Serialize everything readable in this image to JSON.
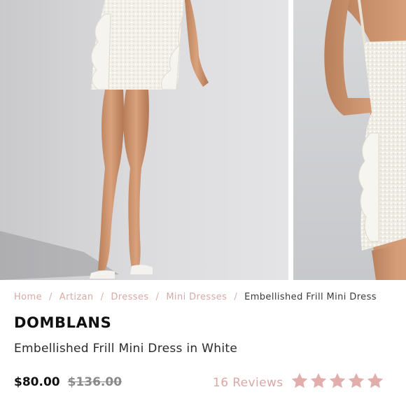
{
  "breadcrumb": [
    {
      "label": "Home"
    },
    {
      "label": "Artizan"
    },
    {
      "label": "Dresses"
    },
    {
      "label": "Mini Dresses"
    }
  ],
  "breadcrumb_separator": "/",
  "breadcrumb_current": "Embellished Frill Mini Dress",
  "product": {
    "brand": "DOMBLANS",
    "name": "Embellished Frill Mini Dress in White",
    "price": "$80.00",
    "original_price": "$136.00",
    "reviews_label": "16 Reviews",
    "rating": 5,
    "rating_max": 5
  },
  "colors": {
    "accent_pink": "#dba7a4",
    "star": "#e2aeac",
    "text_dark": "#111111",
    "text_muted": "#8a8a8a"
  },
  "icons": {
    "star": "star-icon",
    "photo": "product-photo"
  }
}
